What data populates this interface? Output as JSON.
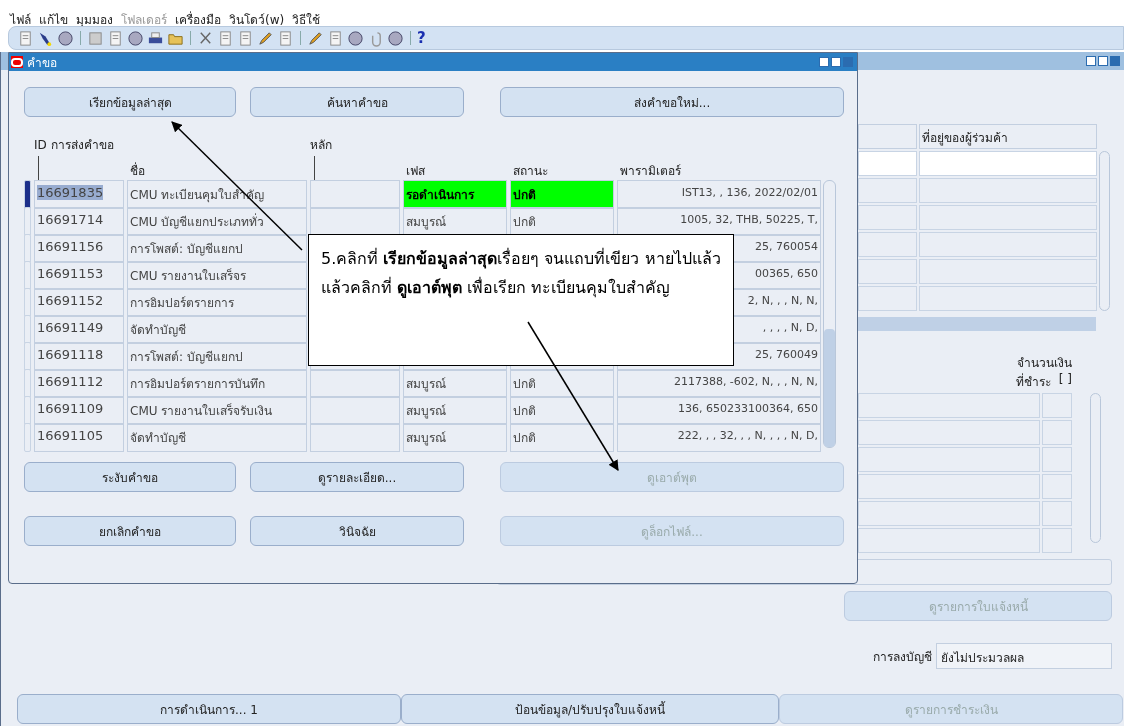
{
  "menu": [
    {
      "label": "ไฟล์",
      "disabled": false
    },
    {
      "label": "แก้ไข",
      "disabled": false
    },
    {
      "label": "มุมมอง",
      "disabled": false
    },
    {
      "label": "โฟลเดอร์",
      "disabled": true
    },
    {
      "label": "เครื่องมือ",
      "disabled": false
    },
    {
      "label": "วินโดว์(w)",
      "disabled": false
    },
    {
      "label": "วิธีใช้",
      "disabled": false
    }
  ],
  "toolbar": {
    "help": "?"
  },
  "back_window": {
    "column_2": "ที่อยู่ของผู้ร่วมค้า",
    "amount_header": [
      "จำนวนเงิน",
      "ที่ชำระ"
    ],
    "amount_bracket": "[ ]",
    "invoice_list_button": {
      "label": "ดูรายการใบแจ้งหนี้",
      "disabled": true
    },
    "posting": {
      "label": "การลงบัญชี",
      "value": "ยังไม่ประมวลผล"
    },
    "buttons": [
      {
        "label": "การดำเนินการ... 1",
        "disabled": false
      },
      {
        "label": "ป้อนข้อมูล/ปรับปรุงใบแจ้งหนี้",
        "disabled": false
      },
      {
        "label": "ดูรายการชำระเงิน",
        "disabled": true
      }
    ]
  },
  "requests_window": {
    "title": "คำขอ",
    "top_buttons": [
      {
        "label": "เรียกข้อมูลล่าสุด",
        "disabled": false
      },
      {
        "label": "ค้นหาคำขอ",
        "disabled": false
      },
      {
        "label": "ส่งคำขอใหม่...",
        "disabled": false
      }
    ],
    "columns": {
      "id": "ID การส่งคำขอ",
      "main": "หลัก",
      "name": "ชื่อ",
      "phase": "เฟส",
      "status": "สถานะ",
      "parameters": "พารามิเตอร์"
    },
    "rows": [
      {
        "id": "16691835",
        "name": "CMU ทะเบียนคุมใบสำคัญ",
        "phase": "รอดำเนินการ",
        "status": "ปกติ",
        "parameters": "IST13, , 136, 2022/02/01",
        "selected": true,
        "highlighted": true
      },
      {
        "id": "16691714",
        "name": "CMU บัญชีแยกประเภททั่ว",
        "phase": "สมบูรณ์",
        "status": "ปกติ",
        "parameters": "1005, 32, THB, 50225, T,",
        "selected": false,
        "highlighted": false
      },
      {
        "id": "16691156",
        "name": "การโพสต์: บัญชีแยกป",
        "parameters": "25, 760054",
        "selected": false
      },
      {
        "id": "16691153",
        "name": "CMU รายงานใบเสร็จร",
        "parameters": "00365, 650",
        "selected": false
      },
      {
        "id": "16691152",
        "name": "การอิมปอร์ตรายการ",
        "parameters": "2, N, , , N, N,",
        "selected": false
      },
      {
        "id": "16691149",
        "name": "จัดทำบัญชี",
        "parameters": ", , , , N, D,",
        "selected": false
      },
      {
        "id": "16691118",
        "name": "การโพสต์: บัญชีแยกป",
        "parameters": "25, 760049",
        "selected": false
      },
      {
        "id": "16691112",
        "name": "การอิมปอร์ตรายการบันทึก",
        "phase": "สมบูรณ์",
        "status": "ปกติ",
        "parameters": "2117388, -602, N, , , N, N,",
        "selected": false,
        "highlighted": false
      },
      {
        "id": "16691109",
        "name": "CMU รายงานใบเสร็จรับเงิน",
        "phase": "สมบูรณ์",
        "status": "ปกติ",
        "parameters": "136, 650233100364, 650",
        "selected": false,
        "highlighted": false
      },
      {
        "id": "16691105",
        "name": "จัดทำบัญชี",
        "phase": "สมบูรณ์",
        "status": "ปกติ",
        "parameters": "222, , , 32, , , N, , , , N, D,",
        "selected": false,
        "highlighted": false
      }
    ],
    "bottom_buttons": [
      [
        {
          "label": "ระงับคำขอ",
          "disabled": false
        },
        {
          "label": "ดูรายละเอียด...",
          "disabled": false
        },
        {
          "label": "ดูเอาต์พุต",
          "disabled": true
        }
      ],
      [
        {
          "label": "ยกเลิกคำขอ",
          "disabled": false
        },
        {
          "label": "วินิจฉัย",
          "disabled": false
        },
        {
          "label": "ดูล็อกไฟล์...",
          "disabled": true
        }
      ]
    ]
  },
  "callout": {
    "text": "5.คลิกที่ **เรียกข้อมูลล่าสุด**เรื่อยๆ จนแถบที่เขียว หายไปแล้ว แล้วคลิกที่ **ดูเอาต์พุต** เพื่อเรียก ทะเบียนคุมใบสำคัญ"
  }
}
